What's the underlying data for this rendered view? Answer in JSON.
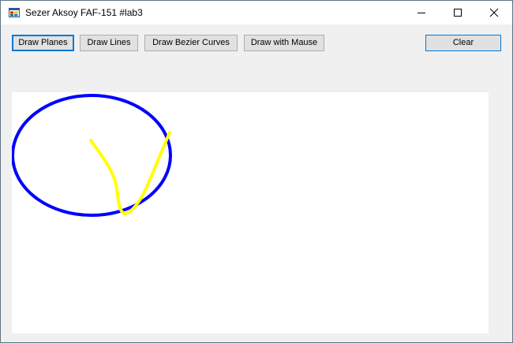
{
  "window": {
    "title": "Sezer Aksoy FAF-151 #lab3"
  },
  "toolbar": {
    "draw_planes_label": "Draw Planes",
    "draw_lines_label": "Draw Lines",
    "draw_bezier_label": "Draw Bezier Curves",
    "draw_mouse_label": "Draw with Mause",
    "clear_label": "Clear"
  },
  "canvas": {
    "background": "#ffffff",
    "shapes": [
      {
        "type": "ellipse",
        "color": "#0000ff"
      },
      {
        "type": "freehand-curve",
        "color": "#ffff00"
      }
    ]
  },
  "icons": {
    "app": "app-window-icon",
    "minimize": "minimize-icon",
    "maximize": "maximize-icon",
    "close": "close-icon"
  }
}
